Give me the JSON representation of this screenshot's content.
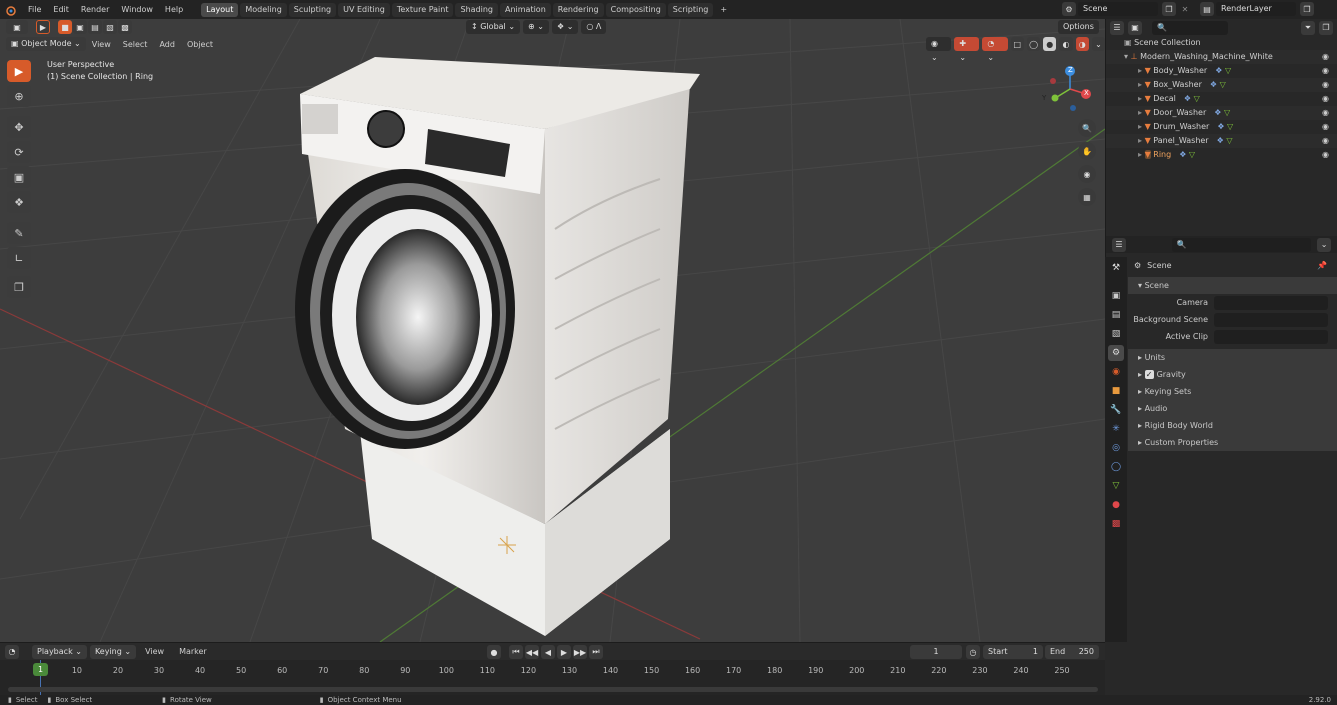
{
  "topbar": {
    "menus": [
      "File",
      "Edit",
      "Render",
      "Window",
      "Help"
    ],
    "workspaces": [
      "Layout",
      "Modeling",
      "Sculpting",
      "UV Editing",
      "Texture Paint",
      "Shading",
      "Animation",
      "Rendering",
      "Compositing",
      "Scripting"
    ],
    "active_workspace": "Layout",
    "add_tab": "+",
    "scene_field": "Scene",
    "renderlayer_field": "RenderLayer"
  },
  "viewport_header": {
    "transform_orientation": "Global",
    "options": "Options",
    "mode": "Object Mode",
    "menus": [
      "View",
      "Select",
      "Add",
      "Object"
    ]
  },
  "viewport": {
    "perspective": "User Perspective",
    "collection_info": "(1) Scene Collection | Ring",
    "axis_labels": {
      "x": "X",
      "y": "Y",
      "z": "Z"
    }
  },
  "outliner": {
    "root": "Scene Collection",
    "collection": "Modern_Washing_Machine_White",
    "objects": [
      "Body_Washer",
      "Box_Washer",
      "Decal",
      "Door_Washer",
      "Drum_Washer",
      "Panel_Washer",
      "Ring"
    ],
    "selected": "Ring"
  },
  "properties": {
    "breadcrumb": "Scene",
    "section": "Scene",
    "fields": [
      {
        "label": "Camera",
        "value": ""
      },
      {
        "label": "Background Scene",
        "value": ""
      },
      {
        "label": "Active Clip",
        "value": ""
      }
    ],
    "subsections": [
      "Units",
      "Gravity",
      "Keying Sets",
      "Audio",
      "Rigid Body World",
      "Custom Properties"
    ],
    "gravity_checked": true
  },
  "timeline": {
    "menus": [
      "Playback",
      "Keying",
      "View",
      "Marker"
    ],
    "current_frame": "1",
    "start_label": "Start",
    "start_value": "1",
    "end_label": "End",
    "end_value": "250",
    "ticks": [
      "1",
      "10",
      "20",
      "30",
      "40",
      "50",
      "60",
      "70",
      "80",
      "90",
      "100",
      "110",
      "120",
      "130",
      "140",
      "150",
      "160",
      "170",
      "180",
      "190",
      "200",
      "210",
      "220",
      "230",
      "240",
      "250"
    ]
  },
  "statusbar": {
    "select": "Select",
    "box_select": "Box Select",
    "rotate_view": "Rotate View",
    "context_menu": "Object Context Menu",
    "version": "2.92.0"
  },
  "colors": {
    "accent": "#d75b2a",
    "axis_x": "#e0484b",
    "axis_y": "#7fc23a",
    "axis_z": "#3c8ee0",
    "selection_blue": "#4772b3"
  }
}
